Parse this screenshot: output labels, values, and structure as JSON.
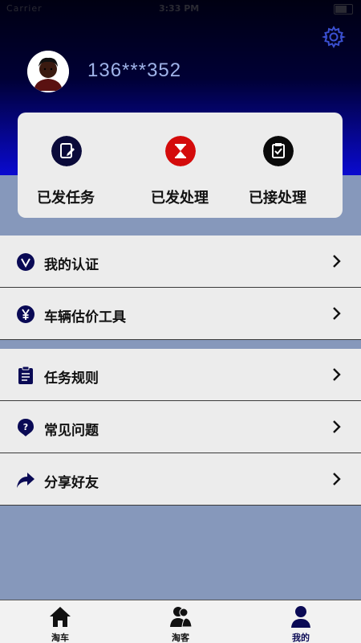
{
  "status_bar": {
    "carrier": "Carrier",
    "time": "3:33 PM"
  },
  "profile": {
    "phone": "136***352"
  },
  "quick_actions": [
    {
      "label": "已发任务",
      "icon": "edit-doc-icon",
      "color": "#0a0a3a"
    },
    {
      "label": "已发处理",
      "icon": "hourglass-icon",
      "color": "#d40b0b"
    },
    {
      "label": "已接处理",
      "icon": "checklist-icon",
      "color": "#0a0a0a"
    }
  ],
  "menu_group_1": [
    {
      "label": "我的认证",
      "icon": "verify-icon"
    },
    {
      "label": "车辆估价工具",
      "icon": "yen-icon"
    }
  ],
  "menu_group_2": [
    {
      "label": "任务规则",
      "icon": "clipboard-icon"
    },
    {
      "label": "常见问题",
      "icon": "question-icon"
    },
    {
      "label": "分享好友",
      "icon": "share-icon"
    }
  ],
  "tabs": [
    {
      "label": "淘车",
      "icon": "home-icon",
      "active": false
    },
    {
      "label": "淘客",
      "icon": "people-icon",
      "active": false
    },
    {
      "label": "我的",
      "icon": "person-icon",
      "active": true
    }
  ],
  "colors": {
    "header_top": "#000012",
    "header_bottom": "#0a0a7a",
    "page_background": "#8698bb",
    "card_background": "#ececec",
    "accent_navy": "#0a0a55"
  }
}
